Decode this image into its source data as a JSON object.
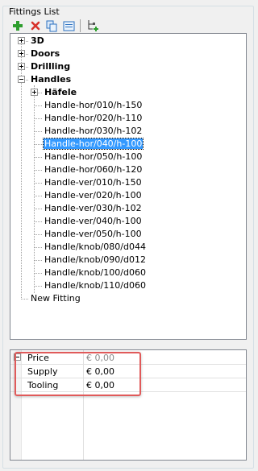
{
  "panel": {
    "title": "Fittings List"
  },
  "toolbar": {
    "buttons": [
      {
        "icon": "add-icon",
        "color": "#2e9e2e"
      },
      {
        "icon": "delete-icon",
        "color": "#d8322b"
      },
      {
        "icon": "copy-icon",
        "color": "#2a6fbf"
      },
      {
        "icon": "properties-icon",
        "color": "#2a6fbf"
      },
      {
        "icon": "tree-add-icon",
        "color": "#2e9e2e"
      }
    ]
  },
  "tree": {
    "nodes": [
      {
        "label": "3D",
        "bold": true,
        "expander": "plus"
      },
      {
        "label": "Doors",
        "bold": true,
        "expander": "plus"
      },
      {
        "label": "Drillling",
        "bold": true,
        "expander": "plus"
      },
      {
        "label": "Handles",
        "bold": true,
        "expander": "minus"
      },
      {
        "label": "Häfele",
        "bold": true,
        "expander": "plus"
      },
      {
        "label": "Handle-hor/010/h-150"
      },
      {
        "label": "Handle-hor/020/h-110"
      },
      {
        "label": "Handle-hor/030/h-102"
      },
      {
        "label": "Handle-hor/040/h-100",
        "selected": true
      },
      {
        "label": "Handle-hor/050/h-100"
      },
      {
        "label": "Handle-hor/060/h-120"
      },
      {
        "label": "Handle-ver/010/h-150"
      },
      {
        "label": "Handle-ver/020/h-100"
      },
      {
        "label": "Handle-ver/030/h-102"
      },
      {
        "label": "Handle-ver/040/h-100"
      },
      {
        "label": "Handle-ver/050/h-100"
      },
      {
        "label": "Handle/knob/080/d044"
      },
      {
        "label": "Handle/knob/090/d012"
      },
      {
        "label": "Handle/knob/100/d060"
      },
      {
        "label": "Handle/knob/110/d060"
      },
      {
        "label": "New Fitting"
      }
    ]
  },
  "properties": {
    "rows": [
      {
        "name": "Price",
        "value": "€ 0,00",
        "grey": true
      },
      {
        "name": "Supply",
        "value": "€ 0,00"
      },
      {
        "name": "Tooling",
        "value": "€ 0,00"
      }
    ]
  },
  "colors": {
    "selection": "#3399ff",
    "highlight_border": "#e05a5a"
  }
}
